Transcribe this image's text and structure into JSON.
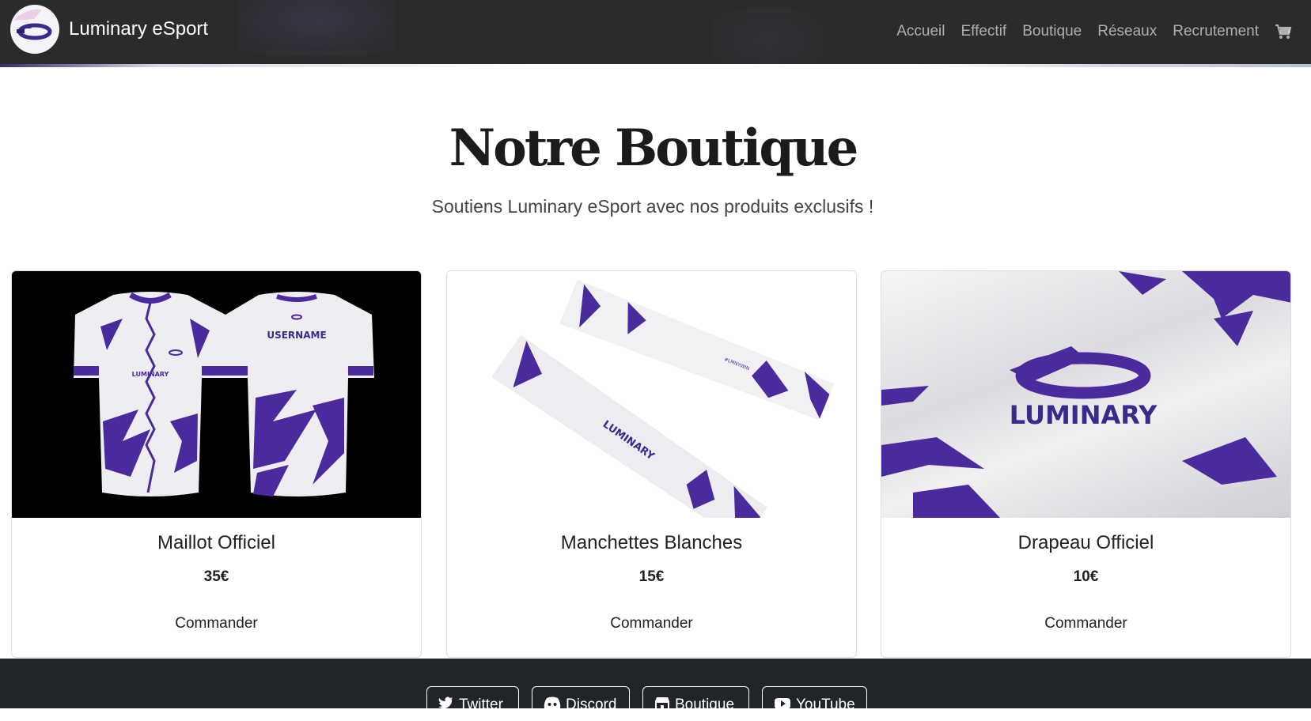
{
  "nav": {
    "brand": "Luminary eSport",
    "links": [
      "Accueil",
      "Effectif",
      "Boutique",
      "Réseaux",
      "Recrutement"
    ],
    "cart_icon": "cart-icon"
  },
  "hero": {
    "title": "Notre Boutique",
    "subtitle": "Soutiens Luminary eSport avec nos produits exclusifs !"
  },
  "products": [
    {
      "name": "Maillot Officiel",
      "price": "35€",
      "button": "Commander",
      "jersey_back_text": "USERNAME",
      "jersey_front_text": "LUMINARY"
    },
    {
      "name": "Manchettes Blanches",
      "price": "15€",
      "button": "Commander",
      "sleeve_text": "LUMINARY",
      "sleeve_tag": "#LMNYWIN"
    },
    {
      "name": "Drapeau Officiel",
      "price": "10€",
      "button": "Commander",
      "flag_text": "LUMINARY"
    }
  ],
  "footer": {
    "buttons": [
      {
        "label": "Twitter",
        "icon": "twitter-icon"
      },
      {
        "label": "Discord",
        "icon": "discord-icon"
      },
      {
        "label": "Boutique",
        "icon": "shop-icon"
      },
      {
        "label": "YouTube",
        "icon": "youtube-icon"
      }
    ]
  },
  "colors": {
    "brand_purple": "#4a2a9c",
    "navbar": "#2b2b2b",
    "footer": "#212529"
  }
}
